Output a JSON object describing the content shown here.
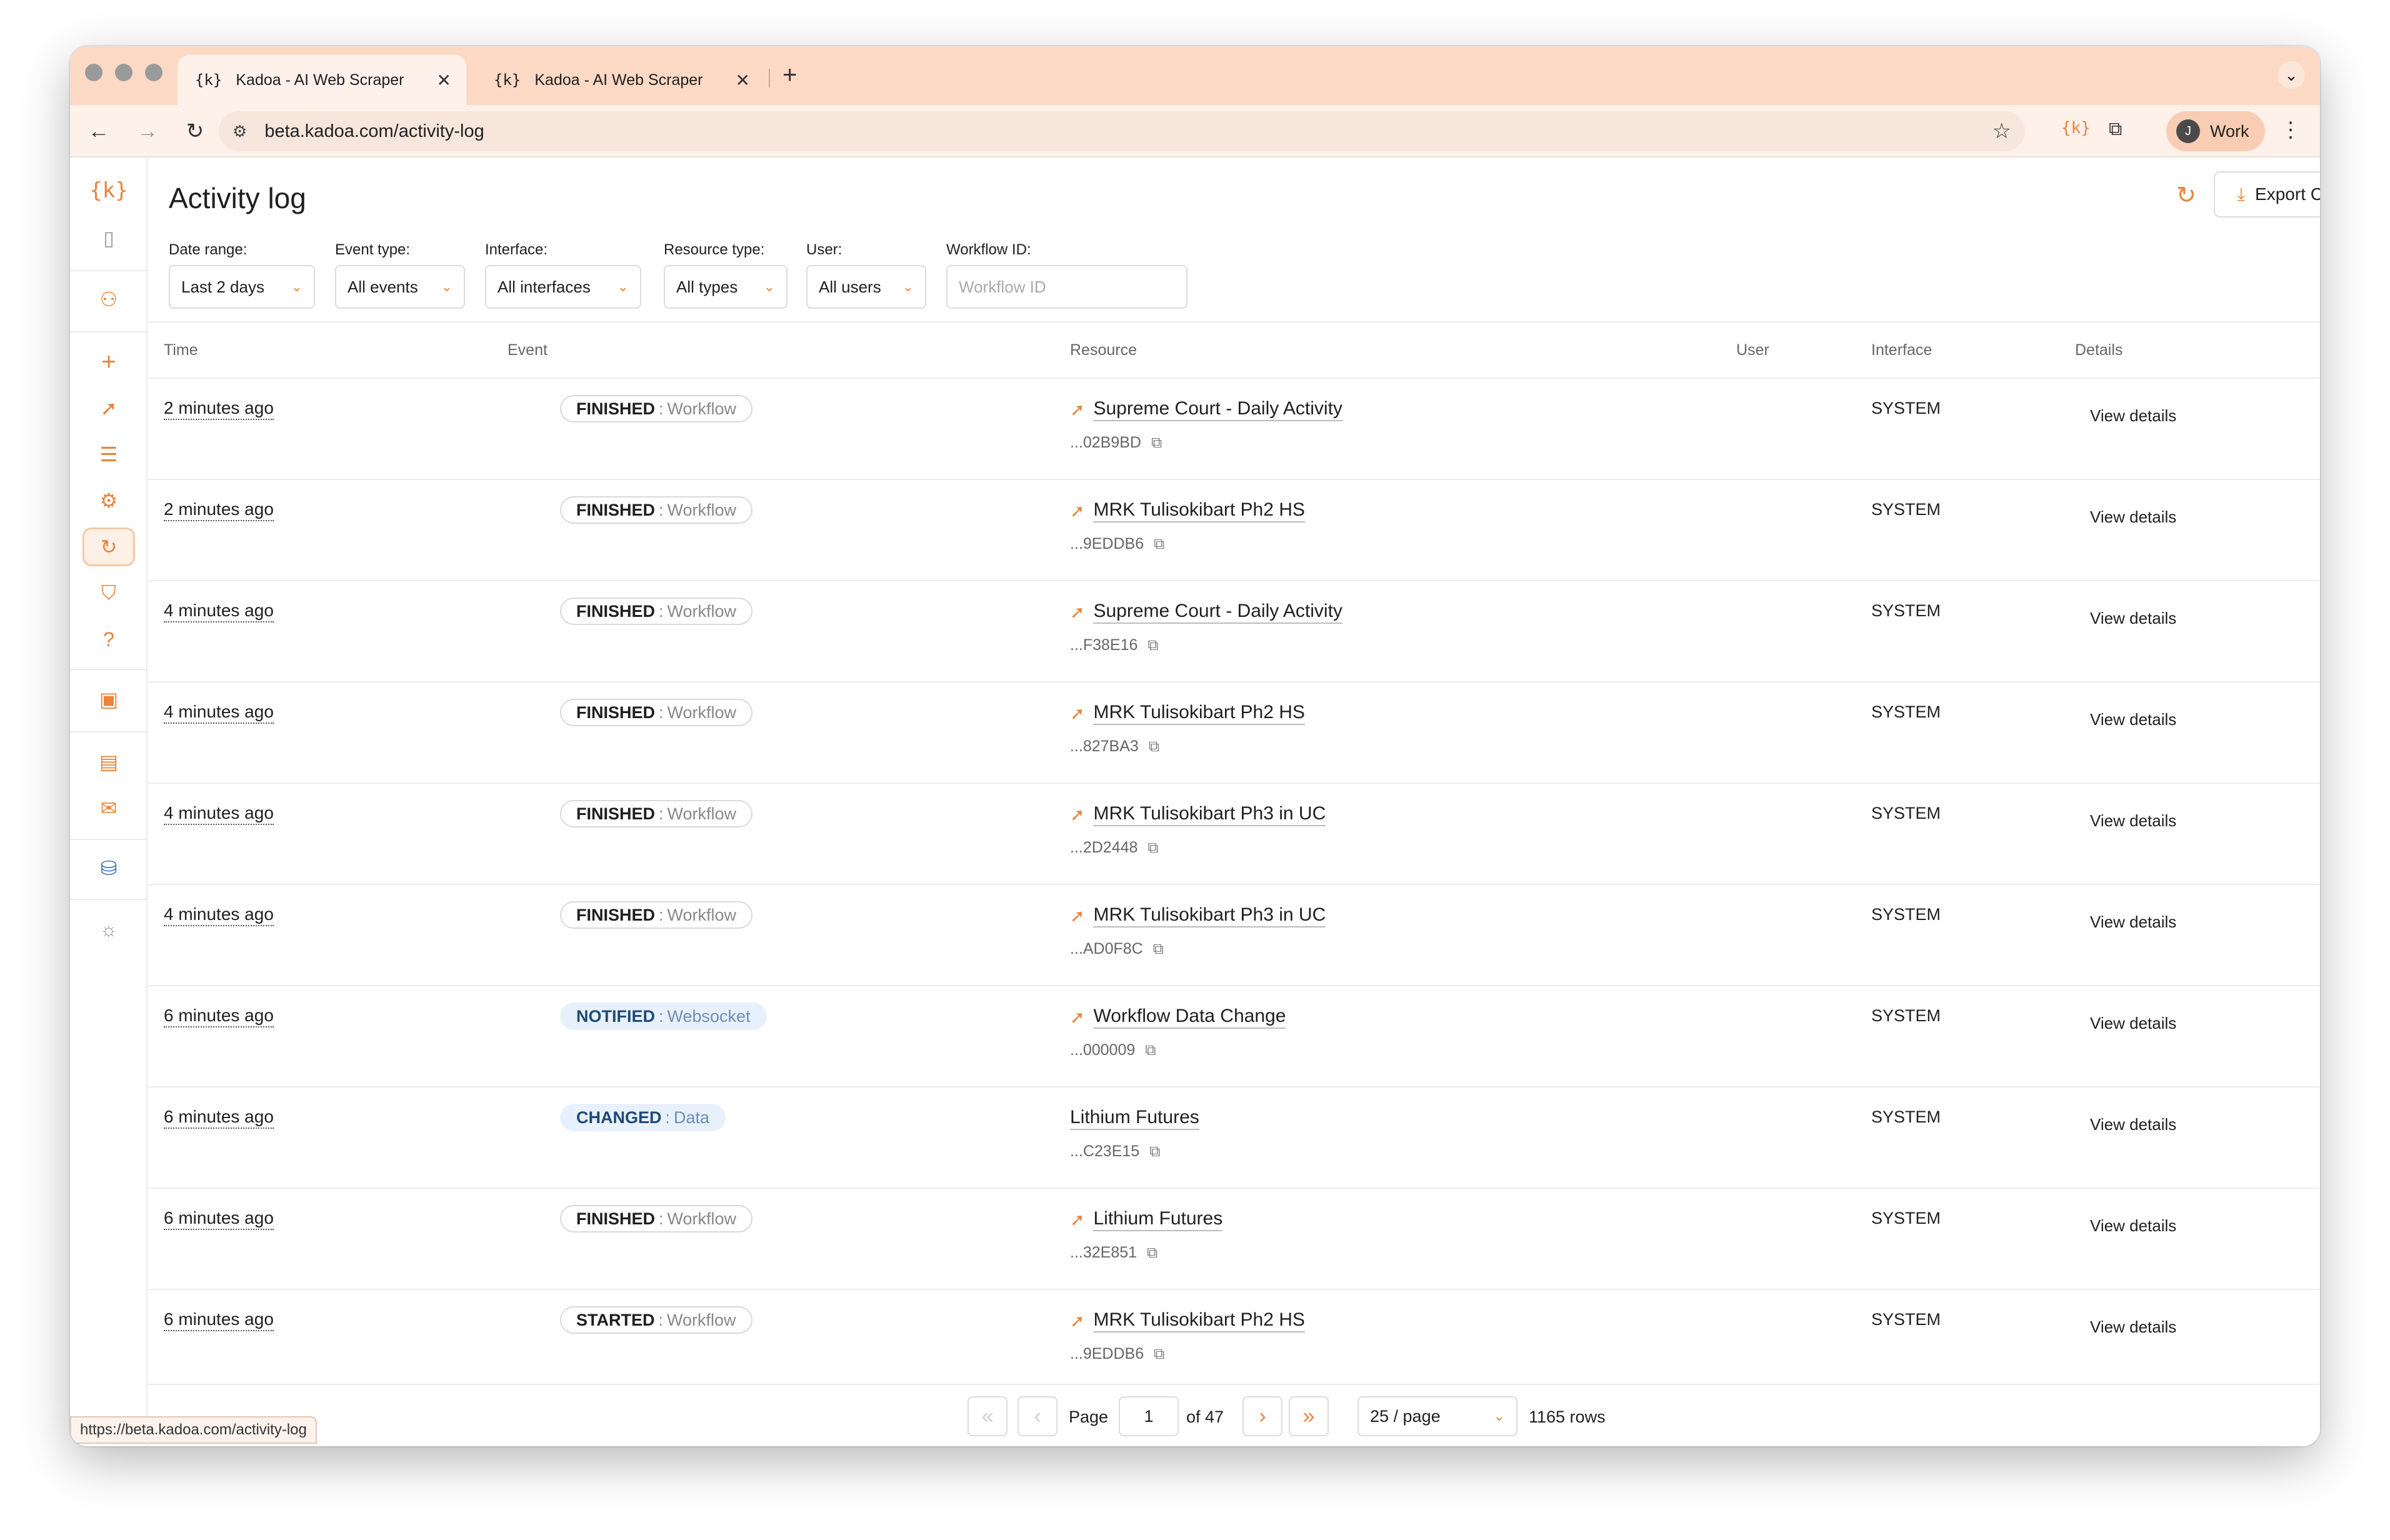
{
  "browser": {
    "tabs": [
      {
        "favicon": "{k}",
        "title": "Kadoa - AI Web Scraper",
        "active": true
      },
      {
        "favicon": "{k}",
        "title": "Kadoa - AI Web Scraper",
        "active": false
      }
    ],
    "url": "beta.kadoa.com/activity-log",
    "profile_initial": "J",
    "profile_label": "Work",
    "status_url": "https://beta.kadoa.com/activity-log"
  },
  "sidebar": {
    "logo": "{k}",
    "items": [
      "sidebar-toggle-icon",
      "team-icon",
      "add-icon",
      "rocket-icon",
      "list-icon",
      "gear-icon",
      "activity-icon",
      "shield-icon",
      "help-icon",
      "contacts-icon",
      "book-icon",
      "mail-icon",
      "incognito-icon",
      "sun-icon"
    ],
    "accent_color": "#e8843a"
  },
  "page": {
    "title": "Activity log",
    "export_label": "Export CSV"
  },
  "filters": {
    "date_range": {
      "label": "Date range:",
      "value": "Last 2 days"
    },
    "event_type": {
      "label": "Event type:",
      "value": "All events"
    },
    "interface": {
      "label": "Interface:",
      "value": "All interfaces"
    },
    "resource_type": {
      "label": "Resource type:",
      "value": "All types"
    },
    "user": {
      "label": "User:",
      "value": "All users"
    },
    "workflow_id": {
      "label": "Workflow ID:",
      "placeholder": "Workflow ID"
    }
  },
  "table": {
    "columns": [
      "Time",
      "Event",
      "Resource",
      "User",
      "Interface",
      "Details"
    ],
    "rows": [
      {
        "time": "2 minutes ago",
        "event_action": "FINISHED",
        "event_target": "Workflow",
        "event_style": "neutral",
        "resource_icon": true,
        "resource_name": "Supreme Court - Daily Activity",
        "resource_id": "...02B9BD",
        "interface": "SYSTEM",
        "details": "View details"
      },
      {
        "time": "2 minutes ago",
        "event_action": "FINISHED",
        "event_target": "Workflow",
        "event_style": "neutral",
        "resource_icon": true,
        "resource_name": "MRK Tulisokibart Ph2 HS",
        "resource_id": "...9EDDB6",
        "interface": "SYSTEM",
        "details": "View details"
      },
      {
        "time": "4 minutes ago",
        "event_action": "FINISHED",
        "event_target": "Workflow",
        "event_style": "neutral",
        "resource_icon": true,
        "resource_name": "Supreme Court - Daily Activity",
        "resource_id": "...F38E16",
        "interface": "SYSTEM",
        "details": "View details"
      },
      {
        "time": "4 minutes ago",
        "event_action": "FINISHED",
        "event_target": "Workflow",
        "event_style": "neutral",
        "resource_icon": true,
        "resource_name": "MRK Tulisokibart Ph2 HS",
        "resource_id": "...827BA3",
        "interface": "SYSTEM",
        "details": "View details"
      },
      {
        "time": "4 minutes ago",
        "event_action": "FINISHED",
        "event_target": "Workflow",
        "event_style": "neutral",
        "resource_icon": true,
        "resource_name": "MRK Tulisokibart Ph3 in UC",
        "resource_id": "...2D2448",
        "interface": "SYSTEM",
        "details": "View details"
      },
      {
        "time": "4 minutes ago",
        "event_action": "FINISHED",
        "event_target": "Workflow",
        "event_style": "neutral",
        "resource_icon": true,
        "resource_name": "MRK Tulisokibart Ph3 in UC",
        "resource_id": "...AD0F8C",
        "interface": "SYSTEM",
        "details": "View details"
      },
      {
        "time": "6 minutes ago",
        "event_action": "NOTIFIED",
        "event_target": "Websocket",
        "event_style": "blue",
        "resource_icon": true,
        "resource_name": "Workflow Data Change",
        "resource_id": "...000009",
        "interface": "SYSTEM",
        "details": "View details"
      },
      {
        "time": "6 minutes ago",
        "event_action": "CHANGED",
        "event_target": "Data",
        "event_style": "blue",
        "resource_icon": false,
        "resource_name": "Lithium Futures",
        "resource_id": "...C23E15",
        "interface": "SYSTEM",
        "details": "View details"
      },
      {
        "time": "6 minutes ago",
        "event_action": "FINISHED",
        "event_target": "Workflow",
        "event_style": "neutral",
        "resource_icon": true,
        "resource_name": "Lithium Futures",
        "resource_id": "...32E851",
        "interface": "SYSTEM",
        "details": "View details"
      },
      {
        "time": "6 minutes ago",
        "event_action": "STARTED",
        "event_target": "Workflow",
        "event_style": "neutral",
        "resource_icon": true,
        "resource_name": "MRK Tulisokibart Ph2 HS",
        "resource_id": "...9EDDB6",
        "interface": "SYSTEM",
        "details": "View details"
      }
    ]
  },
  "pagination": {
    "page_label": "Page",
    "current_page": "1",
    "of_label": "of 47",
    "page_size": "25 / page",
    "rows_label": "1165 rows"
  }
}
